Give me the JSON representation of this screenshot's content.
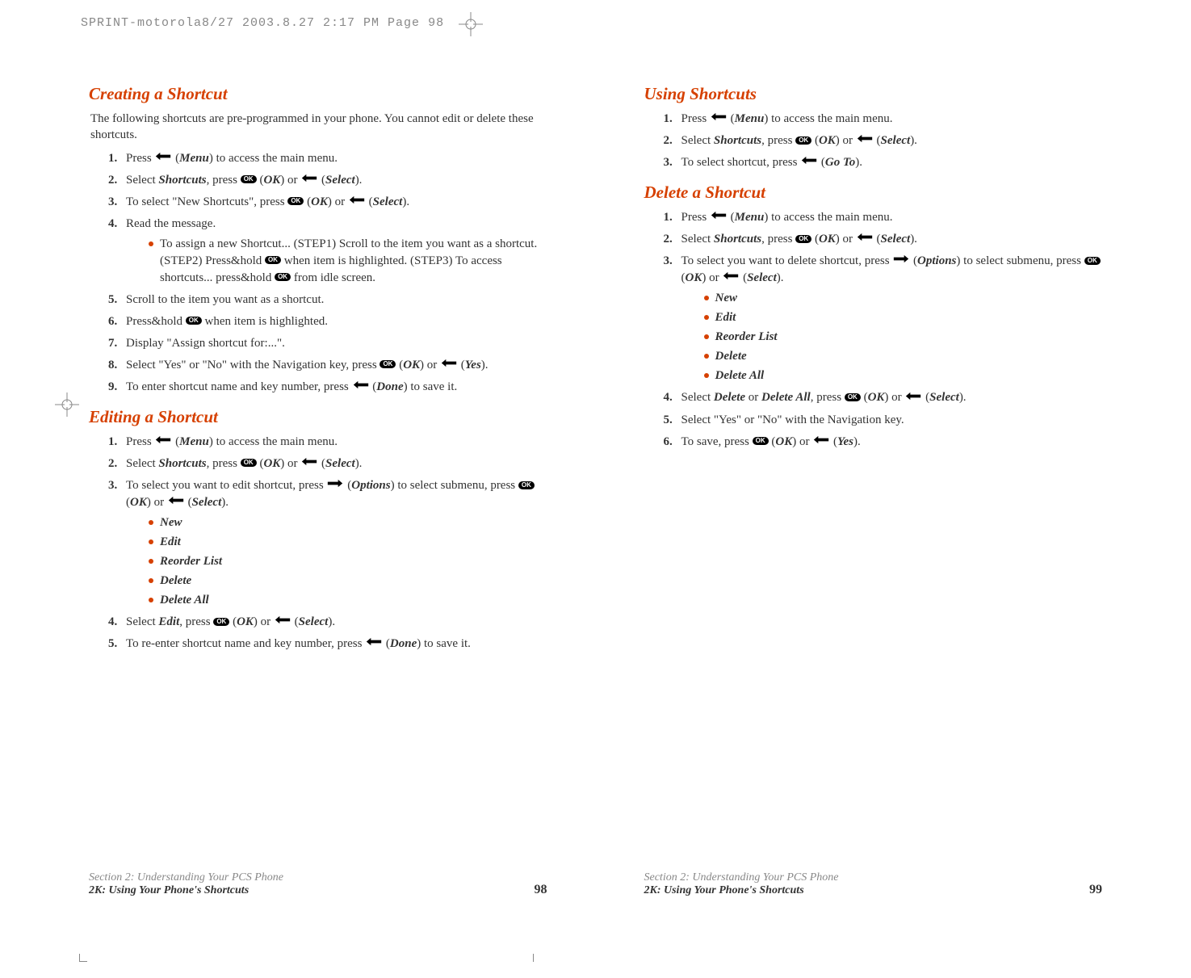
{
  "meta": {
    "header_line": "SPRINT-motorola8/27  2003.8.27  2:17 PM  Page 98"
  },
  "left": {
    "sec1": {
      "title": "Creating a Shortcut",
      "intro": "The following shortcuts are pre-programmed in your phone. You cannot edit or delete these shortcuts.",
      "steps": {
        "s1_a": "Press ",
        "s1_b": " (",
        "s1_menu": "Menu",
        "s1_c": ") to access the main menu.",
        "s2_a": "Select ",
        "s2_short": "Shortcuts",
        "s2_b": ", press ",
        "s2_c": " (",
        "s2_ok": "OK",
        "s2_d": ") or  ",
        "s2_e": " (",
        "s2_sel": "Select",
        "s2_f": ").",
        "s3_a": "To select \"New Shortcuts\", press ",
        "s3_b": " (",
        "s3_ok": "OK",
        "s3_c": ") or  ",
        "s3_d": " (",
        "s3_sel": "Select",
        "s3_e": ").",
        "s4": "Read the message.",
        "s4_bullet_a": "To assign a new Shortcut... (STEP1) Scroll to the item you want as a shortcut. (STEP2) Press&hold ",
        "s4_bullet_b": " when item is highlighted. (STEP3) To access shortcuts... press&hold ",
        "s4_bullet_c": " from idle screen.",
        "s5": "Scroll to the item you want as a shortcut.",
        "s6_a": "Press&hold ",
        "s6_b": " when item is highlighted.",
        "s7": "Display \"Assign shortcut for:...\".",
        "s8_a": "Select \"Yes\" or \"No\" with the Navigation key, press ",
        "s8_b": " (",
        "s8_ok": "OK",
        "s8_c": ") or ",
        "s8_d": " (",
        "s8_yes": "Yes",
        "s8_e": ").",
        "s9_a": "To enter shortcut name and key number, press ",
        "s9_b": " (",
        "s9_done": "Done",
        "s9_c": ") to save it."
      }
    },
    "sec2": {
      "title": "Editing a Shortcut",
      "steps": {
        "s1_a": "Press ",
        "s1_b": " (",
        "s1_menu": "Menu",
        "s1_c": ") to access the main menu.",
        "s2_a": "Select ",
        "s2_short": "Shortcuts",
        "s2_b": ", press ",
        "s2_c": " (",
        "s2_ok": "OK",
        "s2_d": ") or  ",
        "s2_e": " (",
        "s2_sel": "Select",
        "s2_f": ").",
        "s3_a": "To select you want to edit shortcut, press ",
        "s3_b": " (",
        "s3_opt": "Options",
        "s3_c": ") to select submenu, press ",
        "s3_d": " (",
        "s3_ok": "OK",
        "s3_e": ") or  ",
        "s3_f": " (",
        "s3_sel": "Select",
        "s3_g": ").",
        "sub1": "New",
        "sub2": "Edit",
        "sub3": "Reorder List",
        "sub4": "Delete",
        "sub5": "Delete All",
        "s4_a": "Select ",
        "s4_edit": "Edit",
        "s4_b": ", press ",
        "s4_c": " (",
        "s4_ok": "OK",
        "s4_d": ") or  ",
        "s4_e": " (",
        "s4_sel": "Select",
        "s4_f": ").",
        "s5_a": "To re-enter shortcut name and key number, press ",
        "s5_b": " (",
        "s5_done": "Done",
        "s5_c": ") to save it."
      }
    },
    "footer": {
      "line1": "Section 2: Understanding Your PCS Phone",
      "line2": "2K: Using Your Phone's Shortcuts",
      "page": "98"
    }
  },
  "right": {
    "sec1": {
      "title": "Using Shortcuts",
      "steps": {
        "s1_a": "Press ",
        "s1_b": " (",
        "s1_menu": "Menu",
        "s1_c": ") to access the main menu.",
        "s2_a": "Select ",
        "s2_short": "Shortcuts",
        "s2_b": ", press ",
        "s2_c": " (",
        "s2_ok": "OK",
        "s2_d": ") or  ",
        "s2_e": " (",
        "s2_sel": "Select",
        "s2_f": ").",
        "s3_a": "To select shortcut, press ",
        "s3_b": " (",
        "s3_goto": "Go To",
        "s3_c": ")."
      }
    },
    "sec2": {
      "title": "Delete a Shortcut",
      "steps": {
        "s1_a": "Press ",
        "s1_b": " (",
        "s1_menu": "Menu",
        "s1_c": ") to access the main menu.",
        "s2_a": "Select ",
        "s2_short": "Shortcuts",
        "s2_b": ", press ",
        "s2_c": " (",
        "s2_ok": "OK",
        "s2_d": ") or  ",
        "s2_e": " (",
        "s2_sel": "Select",
        "s2_f": ").",
        "s3_a": "To select you want to delete shortcut, press ",
        "s3_b": " (",
        "s3_opt": "Options",
        "s3_c": ") to select submenu, press ",
        "s3_d": " (",
        "s3_ok": "OK",
        "s3_e": ") or  ",
        "s3_f": " (",
        "s3_sel": "Select",
        "s3_g": ").",
        "sub1": "New",
        "sub2": "Edit",
        "sub3": "Reorder List",
        "sub4": "Delete",
        "sub5": "Delete All",
        "s4_a": "Select ",
        "s4_del": "Delete",
        "s4_or": " or ",
        "s4_delall": "Delete All",
        "s4_b": ", press ",
        "s4_c": " (",
        "s4_ok": "OK",
        "s4_d": ") or  ",
        "s4_e": " (",
        "s4_sel": "Select",
        "s4_f": ").",
        "s5": "Select \"Yes\" or \"No\" with the Navigation key.",
        "s6_a": "To save, press ",
        "s6_b": " (",
        "s6_ok": "OK",
        "s6_c": ") or ",
        "s6_d": " (",
        "s6_yes": "Yes",
        "s6_e": ")."
      }
    },
    "footer": {
      "line1": "Section 2: Understanding Your PCS Phone",
      "line2": "2K: Using Your Phone's Shortcuts",
      "page": "99"
    }
  },
  "icons": {
    "ok_label": "OK"
  }
}
